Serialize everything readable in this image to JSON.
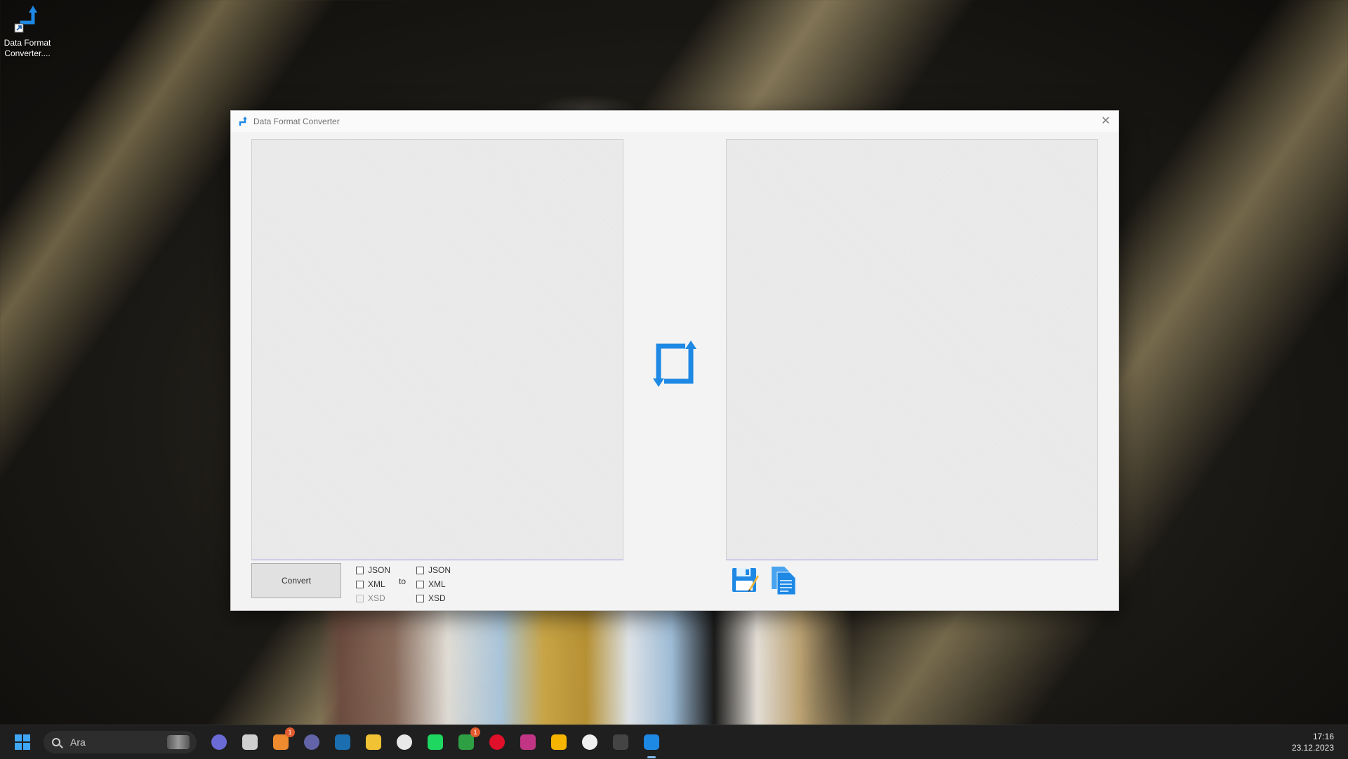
{
  "desktop": {
    "shortcut_label": "Data Format Converter....",
    "shortcut_icon": "data-format-converter-icon"
  },
  "window": {
    "title": "Data Format Converter",
    "close_glyph": "✕",
    "convert_label": "Convert",
    "from_options": [
      {
        "label": "JSON",
        "checked": false,
        "enabled": true
      },
      {
        "label": "XML",
        "checked": false,
        "enabled": true
      },
      {
        "label": "XSD",
        "checked": false,
        "enabled": false
      }
    ],
    "to_label": "to",
    "to_options": [
      {
        "label": "JSON",
        "checked": false,
        "enabled": true
      },
      {
        "label": "XML",
        "checked": false,
        "enabled": true
      },
      {
        "label": "XSD",
        "checked": false,
        "enabled": true
      }
    ],
    "input_text": "",
    "output_text": "",
    "icons": {
      "swap": "swap-arrows-icon",
      "save": "save-icon",
      "copy": "copy-icon"
    }
  },
  "taskbar": {
    "search_placeholder": "Ara",
    "apps": [
      {
        "name": "copilot-pre",
        "color": "#6b6bd6"
      },
      {
        "name": "task-view",
        "color": "#cfcfcf"
      },
      {
        "name": "chat",
        "color": "#f08a2e",
        "badge": "1"
      },
      {
        "name": "teams",
        "color": "#6264a7"
      },
      {
        "name": "steam",
        "color": "#1b6fb0"
      },
      {
        "name": "file-explorer",
        "color": "#f2c235"
      },
      {
        "name": "store",
        "color": "#e8e8e8"
      },
      {
        "name": "spotify",
        "color": "#1ed760"
      },
      {
        "name": "xbox",
        "color": "#2ea043",
        "badge": "1"
      },
      {
        "name": "opera",
        "color": "#e0102a"
      },
      {
        "name": "instagram-app",
        "color": "#c13584"
      },
      {
        "name": "chrome",
        "color": "#f4b400"
      },
      {
        "name": "media-app",
        "color": "#f0f0f0"
      },
      {
        "name": "obs-studio",
        "color": "#444444"
      },
      {
        "name": "data-format-converter",
        "color": "#1e88e5",
        "active": true
      }
    ],
    "time": "17:16",
    "date": "23.12.2023"
  },
  "colors": {
    "accent": "#1e88e5",
    "convert_bg": "#e1e1e1"
  }
}
